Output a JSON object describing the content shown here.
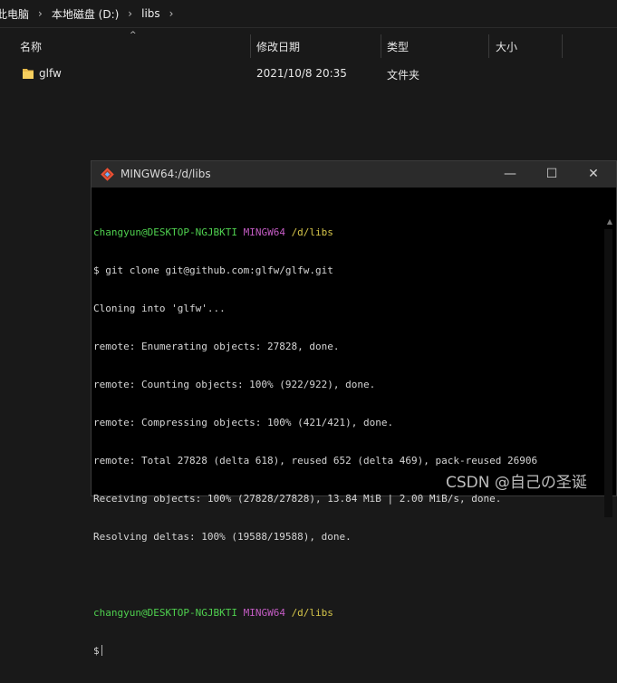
{
  "address": {
    "crumbs": [
      "此电脑",
      "本地磁盘 (D:)",
      "libs"
    ],
    "separator": "›"
  },
  "columns": {
    "name": "名称",
    "modified": "修改日期",
    "type": "类型",
    "size": "大小",
    "sort_indicator": "^"
  },
  "files": [
    {
      "name": "glfw",
      "modified": "2021/10/8 20:35",
      "type": "文件夹",
      "icon": "folder-icon"
    }
  ],
  "terminal": {
    "title": "MINGW64:/d/libs",
    "icon": "git-icon",
    "controls": {
      "minimize": "—",
      "maximize": "☐",
      "close": "✕"
    },
    "prompt1": {
      "user": "changyun@DESKTOP-NGJBKTI",
      "env": "MINGW64",
      "path": "/d/libs"
    },
    "command": "$ git clone git@github.com:glfw/glfw.git",
    "output": [
      "Cloning into 'glfw'...",
      "remote: Enumerating objects: 27828, done.",
      "remote: Counting objects: 100% (922/922), done.",
      "remote: Compressing objects: 100% (421/421), done.",
      "remote: Total 27828 (delta 618), reused 652 (delta 469), pack-reused 26906",
      "Receiving objects: 100% (27828/27828), 13.84 MiB | 2.00 MiB/s, done.",
      "Resolving deltas: 100% (19588/19588), done."
    ],
    "prompt2": {
      "user": "changyun@DESKTOP-NGJBKTI",
      "env": "MINGW64",
      "path": "/d/libs"
    },
    "input_prompt": "$"
  },
  "watermark": "CSDN @自己の圣诞"
}
